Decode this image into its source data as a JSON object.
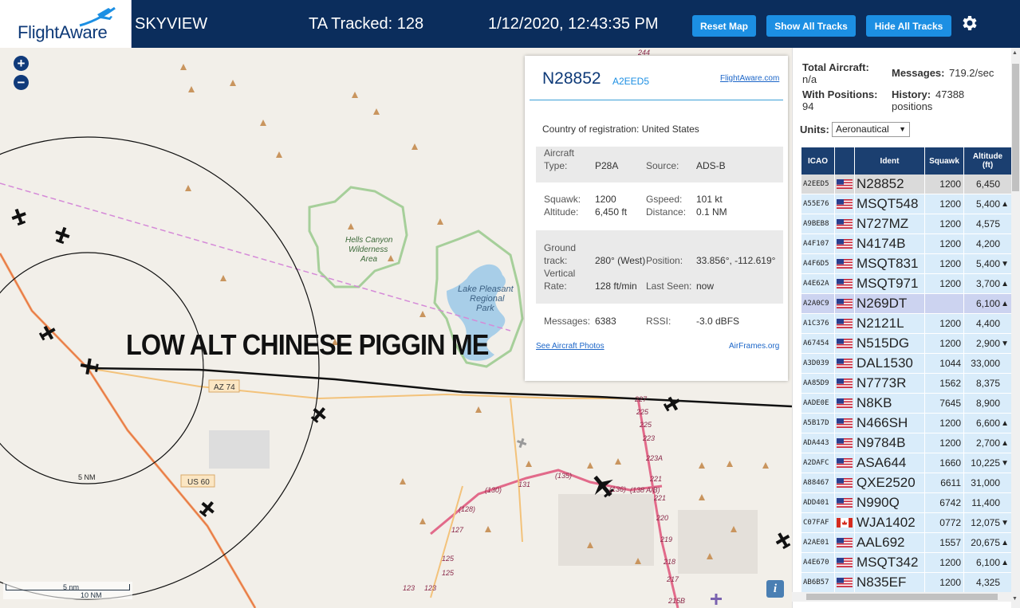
{
  "header": {
    "logo_text": "FlightAware",
    "app_name": "SKYVIEW",
    "tracked_label": "TA Tracked: 128",
    "datetime": "1/12/2020, 12:43:35 PM",
    "reset_label": "Reset Map",
    "show_tracks_label": "Show All Tracks",
    "hide_tracks_label": "Hide All Tracks",
    "settings_icon": "gear-icon"
  },
  "map": {
    "zoom_in": "+",
    "zoom_out": "−",
    "overlay_text": "LOW ALT CHINESE PIGGIN ME",
    "labels": {
      "hells_canyon": "Hells Canyon",
      "wilderness": "Wilderness",
      "area": "Area",
      "lake_pleasant": "Lake Pleasant",
      "regional": "Regional",
      "park": "Park",
      "az74": "AZ 74",
      "us60": "US 60",
      "ring5": "5 NM"
    },
    "route_numbers": {
      "r244": "244",
      "r227": "227",
      "r225a": "225",
      "r225b": "225",
      "r223": "223",
      "r223a": "223A",
      "r221a": "221",
      "r221b": "221",
      "r220": "220",
      "r219": "219",
      "r218": "218",
      "r217": "217",
      "r215b": "215B",
      "r138": "(138 A/B)",
      "r136": "(136)",
      "r135": "(135)",
      "r131": "131",
      "r130": "(130)",
      "r128": "(128)",
      "r127": "127",
      "r125a": "125",
      "r125b": "125",
      "r123a": "123",
      "r123b": "123"
    },
    "scale_top": "5 nm",
    "scale_bottom": "10 NM",
    "info_label": "i",
    "colors": {
      "land": "#f2efe9",
      "water": "#a8cee8",
      "park_border": "#a6cf9a",
      "highway": "#f0a06a",
      "road_pink": "#e26a8a",
      "track": "#111111",
      "range_ring": "#111111"
    }
  },
  "popup": {
    "registration": "N28852",
    "icao": "A2EED5",
    "fa_link": "FlightAware.com",
    "country_label": "Country of registration:",
    "country_value": "United States",
    "aircraft_type_label_1": "Aircraft",
    "aircraft_type_label_2": "Type:",
    "aircraft_type_value": "P28A",
    "source_label": "Source:",
    "source_value": "ADS-B",
    "squawk_label": "Squawk:",
    "squawk_value": "1200",
    "gspeed_label": "Gspeed:",
    "gspeed_value": "101 kt",
    "altitude_label": "Altitude:",
    "altitude_value": "6,450 ft",
    "distance_label": "Distance:",
    "distance_value": "0.1 NM",
    "ground_label_1": "Ground",
    "ground_label_2": "track:",
    "ground_value": "280° (West)",
    "position_label": "Position:",
    "position_value": "33.856°, -112.619°",
    "vrate_label_1": "Vertical",
    "vrate_label_2": "Rate:",
    "vrate_value": "128 ft/min",
    "lastseen_label": "Last Seen:",
    "lastseen_value": "now",
    "messages_label": "Messages:",
    "messages_value": "6383",
    "rssi_label": "RSSI:",
    "rssi_value": "-3.0 dBFS",
    "photos_link": "See Aircraft Photos",
    "airframes_link": "AirFrames.org"
  },
  "panel": {
    "total_label": "Total Aircraft:",
    "total_value": "n/a",
    "withpos_label": "With Positions:",
    "withpos_value": "94",
    "messages_label": "Messages:",
    "messages_value": "719.2/sec",
    "history_label": "History:",
    "history_value": "47388",
    "history_unit": "positions",
    "units_label": "Units:",
    "units_value": "Aeronautical"
  },
  "table": {
    "headers": {
      "icao": "ICAO",
      "ident": "Ident",
      "squawk": "Squawk",
      "alt1": "Altitude",
      "alt2": "(ft)"
    },
    "rows": [
      {
        "icao": "A2EED5",
        "flag": "us",
        "ident": "N28852",
        "squawk": "1200",
        "altitude": "6,450",
        "trend": ""
      },
      {
        "icao": "A55E76",
        "flag": "us",
        "ident": "MSQT548",
        "squawk": "1200",
        "altitude": "5,400",
        "trend": "▲"
      },
      {
        "icao": "A9BEB8",
        "flag": "us",
        "ident": "N727MZ",
        "squawk": "1200",
        "altitude": "4,575",
        "trend": ""
      },
      {
        "icao": "A4F107",
        "flag": "us",
        "ident": "N4174B",
        "squawk": "1200",
        "altitude": "4,200",
        "trend": ""
      },
      {
        "icao": "A4F6D5",
        "flag": "us",
        "ident": "MSQT831",
        "squawk": "1200",
        "altitude": "5,400",
        "trend": "▼"
      },
      {
        "icao": "A4E62A",
        "flag": "us",
        "ident": "MSQT971",
        "squawk": "1200",
        "altitude": "3,700",
        "trend": "▲"
      },
      {
        "icao": "A2A0C9",
        "flag": "us",
        "ident": "N269DT",
        "squawk": "",
        "altitude": "6,100",
        "trend": "▲"
      },
      {
        "icao": "A1C376",
        "flag": "us",
        "ident": "N2121L",
        "squawk": "1200",
        "altitude": "4,400",
        "trend": ""
      },
      {
        "icao": "A67454",
        "flag": "us",
        "ident": "N515DG",
        "squawk": "1200",
        "altitude": "2,900",
        "trend": "▼"
      },
      {
        "icao": "A3D039",
        "flag": "us",
        "ident": "DAL1530",
        "squawk": "1044",
        "altitude": "33,000",
        "trend": ""
      },
      {
        "icao": "AA85D9",
        "flag": "us",
        "ident": "N7773R",
        "squawk": "1562",
        "altitude": "8,375",
        "trend": ""
      },
      {
        "icao": "AADE0E",
        "flag": "us",
        "ident": "N8KB",
        "squawk": "7645",
        "altitude": "8,900",
        "trend": ""
      },
      {
        "icao": "A5B17D",
        "flag": "us",
        "ident": "N466SH",
        "squawk": "1200",
        "altitude": "6,600",
        "trend": "▲"
      },
      {
        "icao": "ADA443",
        "flag": "us",
        "ident": "N9784B",
        "squawk": "1200",
        "altitude": "2,700",
        "trend": "▲"
      },
      {
        "icao": "A2DAFC",
        "flag": "us",
        "ident": "ASA644",
        "squawk": "1660",
        "altitude": "10,225",
        "trend": "▼"
      },
      {
        "icao": "A88467",
        "flag": "us",
        "ident": "QXE2520",
        "squawk": "6611",
        "altitude": "31,000",
        "trend": ""
      },
      {
        "icao": "ADD401",
        "flag": "us",
        "ident": "N990Q",
        "squawk": "6742",
        "altitude": "11,400",
        "trend": ""
      },
      {
        "icao": "C07FAF",
        "flag": "ca",
        "ident": "WJA1402",
        "squawk": "0772",
        "altitude": "12,075",
        "trend": "▼"
      },
      {
        "icao": "A2AE01",
        "flag": "us",
        "ident": "AAL692",
        "squawk": "1557",
        "altitude": "20,675",
        "trend": "▲"
      },
      {
        "icao": "A4E670",
        "flag": "us",
        "ident": "MSQT342",
        "squawk": "1200",
        "altitude": "6,100",
        "trend": "▲"
      },
      {
        "icao": "AB6B57",
        "flag": "us",
        "ident": "N835EF",
        "squawk": "1200",
        "altitude": "4,325",
        "trend": ""
      }
    ],
    "selected_index": 0,
    "highlight_index": 6
  }
}
